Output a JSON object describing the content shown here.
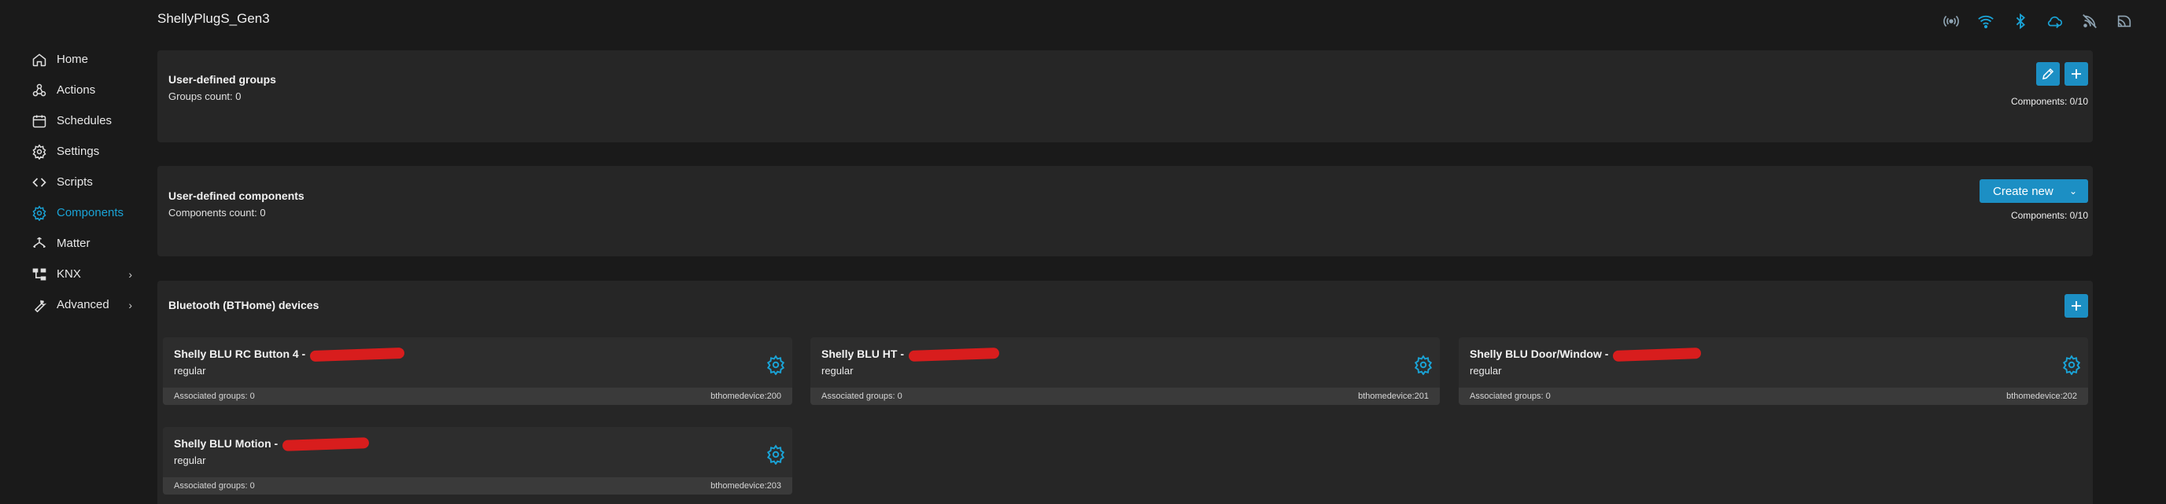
{
  "app": {
    "title": "ShellyPlugS_Gen3"
  },
  "status_icons": [
    "broadcast-icon",
    "wifi-icon",
    "bluetooth-icon",
    "cloud-icon",
    "rss-icon",
    "mqtt-icon"
  ],
  "colors": {
    "accent": "#1aa3d6",
    "button": "#1c8fc4",
    "redaction": "#d81d1d"
  },
  "sidebar": {
    "items": [
      {
        "label": "Home",
        "icon": "home-icon"
      },
      {
        "label": "Actions",
        "icon": "actions-icon"
      },
      {
        "label": "Schedules",
        "icon": "calendar-icon"
      },
      {
        "label": "Settings",
        "icon": "gear-icon"
      },
      {
        "label": "Scripts",
        "icon": "code-icon"
      },
      {
        "label": "Components",
        "icon": "components-icon",
        "active": true
      },
      {
        "label": "Matter",
        "icon": "matter-icon"
      },
      {
        "label": "KNX",
        "icon": "knx-icon",
        "expandable": true
      },
      {
        "label": "Advanced",
        "icon": "wrench-icon",
        "expandable": true
      }
    ]
  },
  "groups": {
    "title": "User-defined groups",
    "count_label": "Groups count: 0",
    "components_count": "Components: 0/10"
  },
  "components": {
    "title": "User-defined components",
    "count_label": "Components count: 0",
    "create_label": "Create new",
    "components_count": "Components: 0/10"
  },
  "bthome": {
    "title": "Bluetooth (BTHome) devices",
    "devices": [
      {
        "title": "Shelly BLU RC Button 4 -",
        "type": "regular",
        "groups": "Associated groups: 0",
        "id": "bthomedevice:200"
      },
      {
        "title": "Shelly BLU HT -",
        "type": "regular",
        "groups": "Associated groups: 0",
        "id": "bthomedevice:201"
      },
      {
        "title": "Shelly BLU Door/Window -",
        "type": "regular",
        "groups": "Associated groups: 0",
        "id": "bthomedevice:202"
      },
      {
        "title": "Shelly BLU Motion -",
        "type": "regular",
        "groups": "Associated groups: 0",
        "id": "bthomedevice:203"
      }
    ]
  }
}
